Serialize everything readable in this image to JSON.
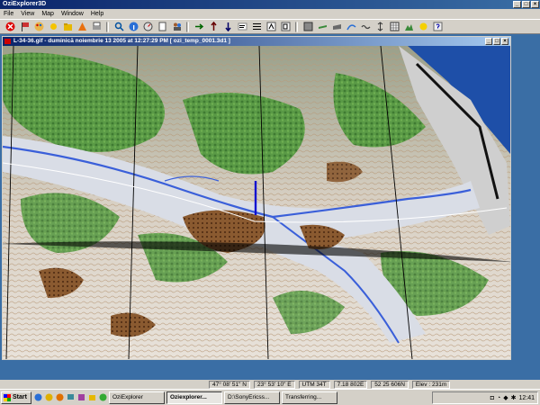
{
  "app": {
    "title": "OziExplorer3D"
  },
  "menu": [
    "File",
    "View",
    "Map",
    "Window",
    "Help"
  ],
  "toolbar": {
    "icons": [
      "close-circle-icon",
      "flag-icon",
      "palette-icon",
      "sun-icon",
      "open-icon",
      "cone-icon",
      "print-icon",
      "find-icon",
      "info-icon",
      "dial-icon",
      "sheet-icon",
      "people-icon",
      "arrow-right-icon",
      "arrow-up-icon",
      "arrow-down-icon",
      "text-icon",
      "lines-icon",
      "a-icon",
      "b-icon",
      "box-icon",
      "plane-icon",
      "plane-alt-icon",
      "curve-icon",
      "wave-icon",
      "up-down-icon",
      "grid-icon",
      "terrain-icon",
      "star-icon",
      "help-icon"
    ]
  },
  "map_window": {
    "title": "L-34-36.gif - duminică noiembrie 13 2005  at  12:27:29 PM  [ ozi_temp_0001.3d1 ]"
  },
  "status": {
    "lat": "47° 08' 51\" N",
    "lon": "23° 53' 10\" E",
    "utm": "UTM  34T",
    "easting": "7.18 802E",
    "northing": "52 25 606N",
    "elev": "Elev : 231m"
  },
  "taskbar": {
    "start_label": "Start",
    "tasks": [
      {
        "label": "OziExplorer",
        "active": false
      },
      {
        "label": "Oziexplorer...",
        "active": true
      },
      {
        "label": "D:\\SonyEricss...",
        "active": false
      },
      {
        "label": "Transferring...",
        "active": false
      }
    ],
    "clock": "12:41"
  },
  "colors": {
    "title_blue": "#0a246a",
    "desktop_blue": "#3a6ea5",
    "river_blue": "#3a5fd9",
    "forest_green": "#4c8a3c"
  }
}
